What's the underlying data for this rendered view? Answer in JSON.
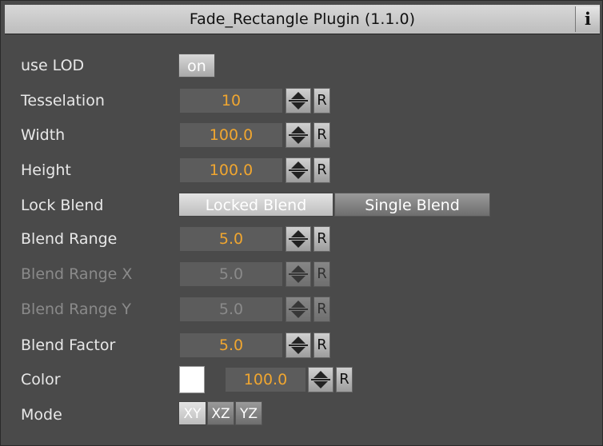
{
  "title": "Fade_Rectangle Plugin (1.1.0)",
  "info_glyph": "i",
  "rows": {
    "use_lod": {
      "label": "use LOD",
      "button": "on"
    },
    "tesselation": {
      "label": "Tesselation",
      "value": "10",
      "reset": "R"
    },
    "width": {
      "label": "Width",
      "value": "100.0",
      "reset": "R"
    },
    "height": {
      "label": "Height",
      "value": "100.0",
      "reset": "R"
    },
    "lock_blend": {
      "label": "Lock Blend",
      "option1": "Locked Blend",
      "option2": "Single Blend"
    },
    "blend_range": {
      "label": "Blend Range",
      "value": "5.0",
      "reset": "R"
    },
    "blend_range_x": {
      "label": "Blend Range X",
      "value": "5.0",
      "reset": "R",
      "enabled": false
    },
    "blend_range_y": {
      "label": "Blend Range Y",
      "value": "5.0",
      "reset": "R",
      "enabled": false
    },
    "blend_factor": {
      "label": "Blend Factor",
      "value": "5.0",
      "reset": "R"
    },
    "color": {
      "label": "Color",
      "swatch": "#ffffff",
      "value": "100.0",
      "reset": "R"
    },
    "mode": {
      "label": "Mode",
      "options": [
        "XY",
        "XZ",
        "YZ"
      ]
    }
  },
  "colors": {
    "accent_value": "#f0a630",
    "panel": "#4a4a4a",
    "label": "#e8e8e8"
  }
}
